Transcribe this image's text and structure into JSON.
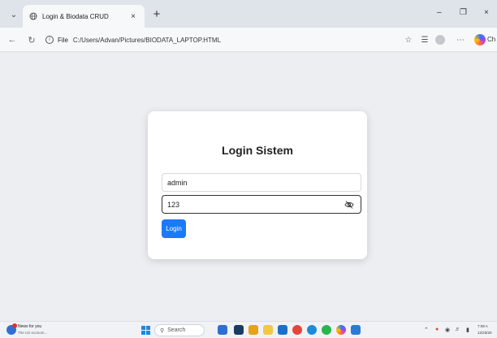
{
  "browser": {
    "tab": {
      "title": "Login & Biodata CRUD",
      "icon": "globe-icon"
    },
    "address": {
      "file_label": "File",
      "url": "C:/Users/Advan/Pictures/BIODATA_LAPTOP.HTML"
    },
    "copilot_label": "Ch"
  },
  "login": {
    "title": "Login Sistem",
    "username_value": "admin",
    "password_value": "123",
    "button_label": "Login",
    "button_color": "#1a7af8"
  },
  "taskbar": {
    "news_title": "News for you",
    "news_subtitle": "The US econom...",
    "search_label": "Search",
    "time": "7:09 A",
    "date": "12/23/20"
  }
}
